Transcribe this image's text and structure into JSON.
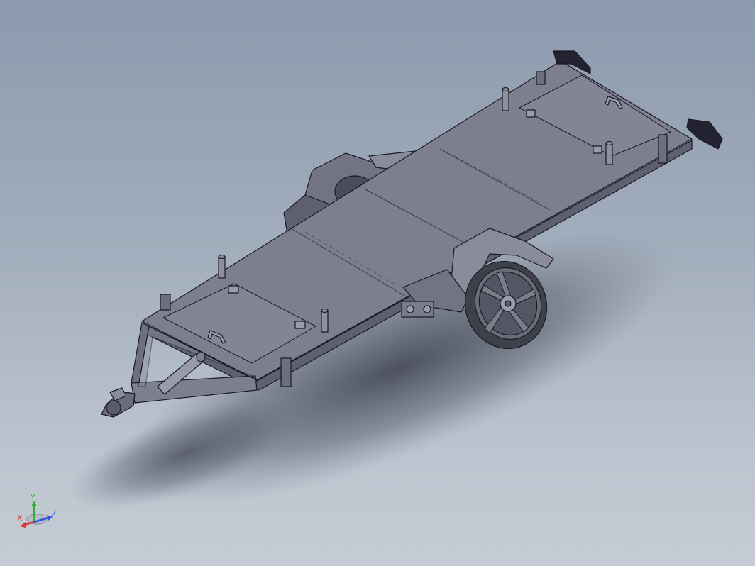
{
  "viewport": {
    "model": "trailer-assembly",
    "render_style": "shaded-with-edges"
  },
  "triad": {
    "x_label": "X",
    "y_label": "Y",
    "z_label": "Z",
    "x_color": "#e03030",
    "y_color": "#30b030",
    "z_color": "#3050e0"
  },
  "colors": {
    "background_top": "#8c9aae",
    "background_bottom": "#c6ccd5",
    "model_fill": "#7d7f8e",
    "model_fill_light": "#8a8c9b",
    "model_fill_dark": "#5e6070",
    "edge": "#1a1a22"
  }
}
